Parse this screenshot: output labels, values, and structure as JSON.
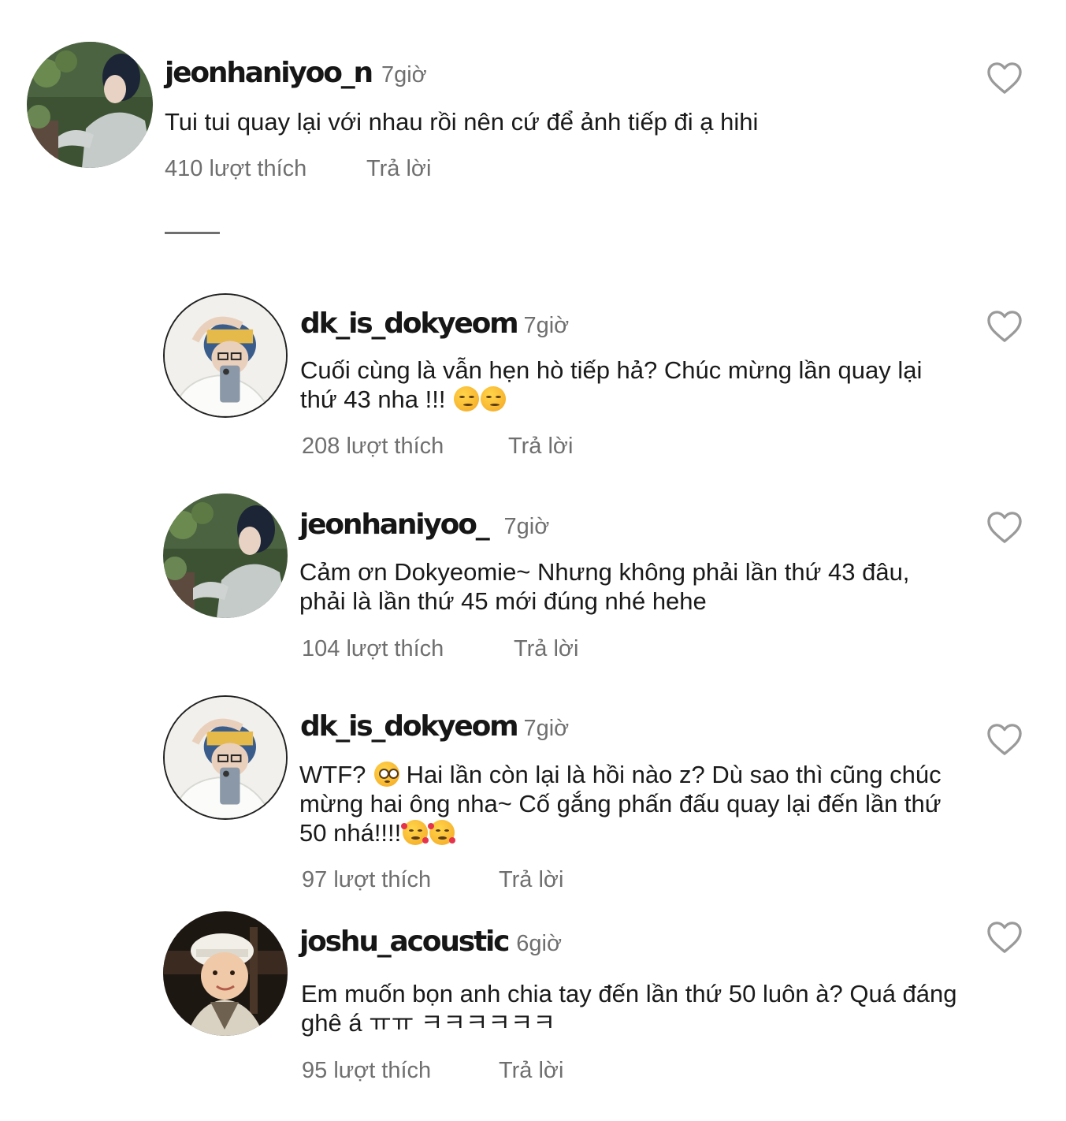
{
  "comments": [
    {
      "username": "jeonhaniyoo_n",
      "time": "7giờ",
      "text": "Tui tui quay lại với nhau rồi nên cứ để ảnh tiếp đi ạ hihi",
      "likes": "410 lượt thích",
      "reply": "Trả lời",
      "avatar_icon": "profile-photo-person-grey-sweater"
    },
    {
      "username": "dk_is_dokyeom",
      "time": "7giờ",
      "text": "Cuối cùng là vẫn hẹn hò tiếp hả? Chúc mừng lần quay lại thứ 43 nha !!! 😏😏",
      "text_main": "Cuối cùng là vẫn hẹn hò tiếp hả? Chúc mừng lần quay lại thứ 43 nha !!!",
      "emoji": "😏😏",
      "likes": "208 lượt thích",
      "reply": "Trả lời",
      "avatar_icon": "profile-photo-mirror-selfie"
    },
    {
      "username": "jeonhaniyoo_",
      "time": "7giờ",
      "text": "Cảm ơn Dokyeomie~ Nhưng không phải lần thứ 43 đâu, phải là lần thứ 45 mới đúng nhé hehe",
      "likes": "104 lượt thích",
      "reply": "Trả lời",
      "avatar_icon": "profile-photo-person-grey-sweater"
    },
    {
      "username": "dk_is_dokyeom",
      "time": "7giờ",
      "text": "WTF? 😳 Hai lần còn lại là hồi nào z? Dù sao thì cũng chúc mừng hai ông nha~ Cố gắng phấn đấu quay lại đến lần thứ 50 nhá!!!!🥰🥰",
      "text_before": "WTF?",
      "emoji_inline": "😳",
      "text_after": "Hai lần còn lại là hồi nào z? Dù sao thì cũng chúc mừng hai ông nha~ Cố gắng phấn đấu quay lại đến lần thứ 50 nhá!!!!",
      "emoji_end": "🥰🥰",
      "likes": "97 lượt thích",
      "reply": "Trả lời",
      "avatar_icon": "profile-photo-mirror-selfie"
    },
    {
      "username": "joshu_acoustic",
      "time": "6giờ",
      "text": "Em muốn bọn anh chia tay đến lần thứ 50 luôn à? Quá đáng ghê á ㅠㅠ ㅋㅋㅋㅋㅋㅋ",
      "likes": "95 lượt thích",
      "reply": "Trả lời",
      "avatar_icon": "profile-photo-child-white-cap"
    }
  ],
  "colors": {
    "text": "#1a1a1a",
    "secondary": "#6f6f6f",
    "heart_outline": "#9a9a9a"
  },
  "icons": {
    "like": "heart-outline-icon"
  }
}
